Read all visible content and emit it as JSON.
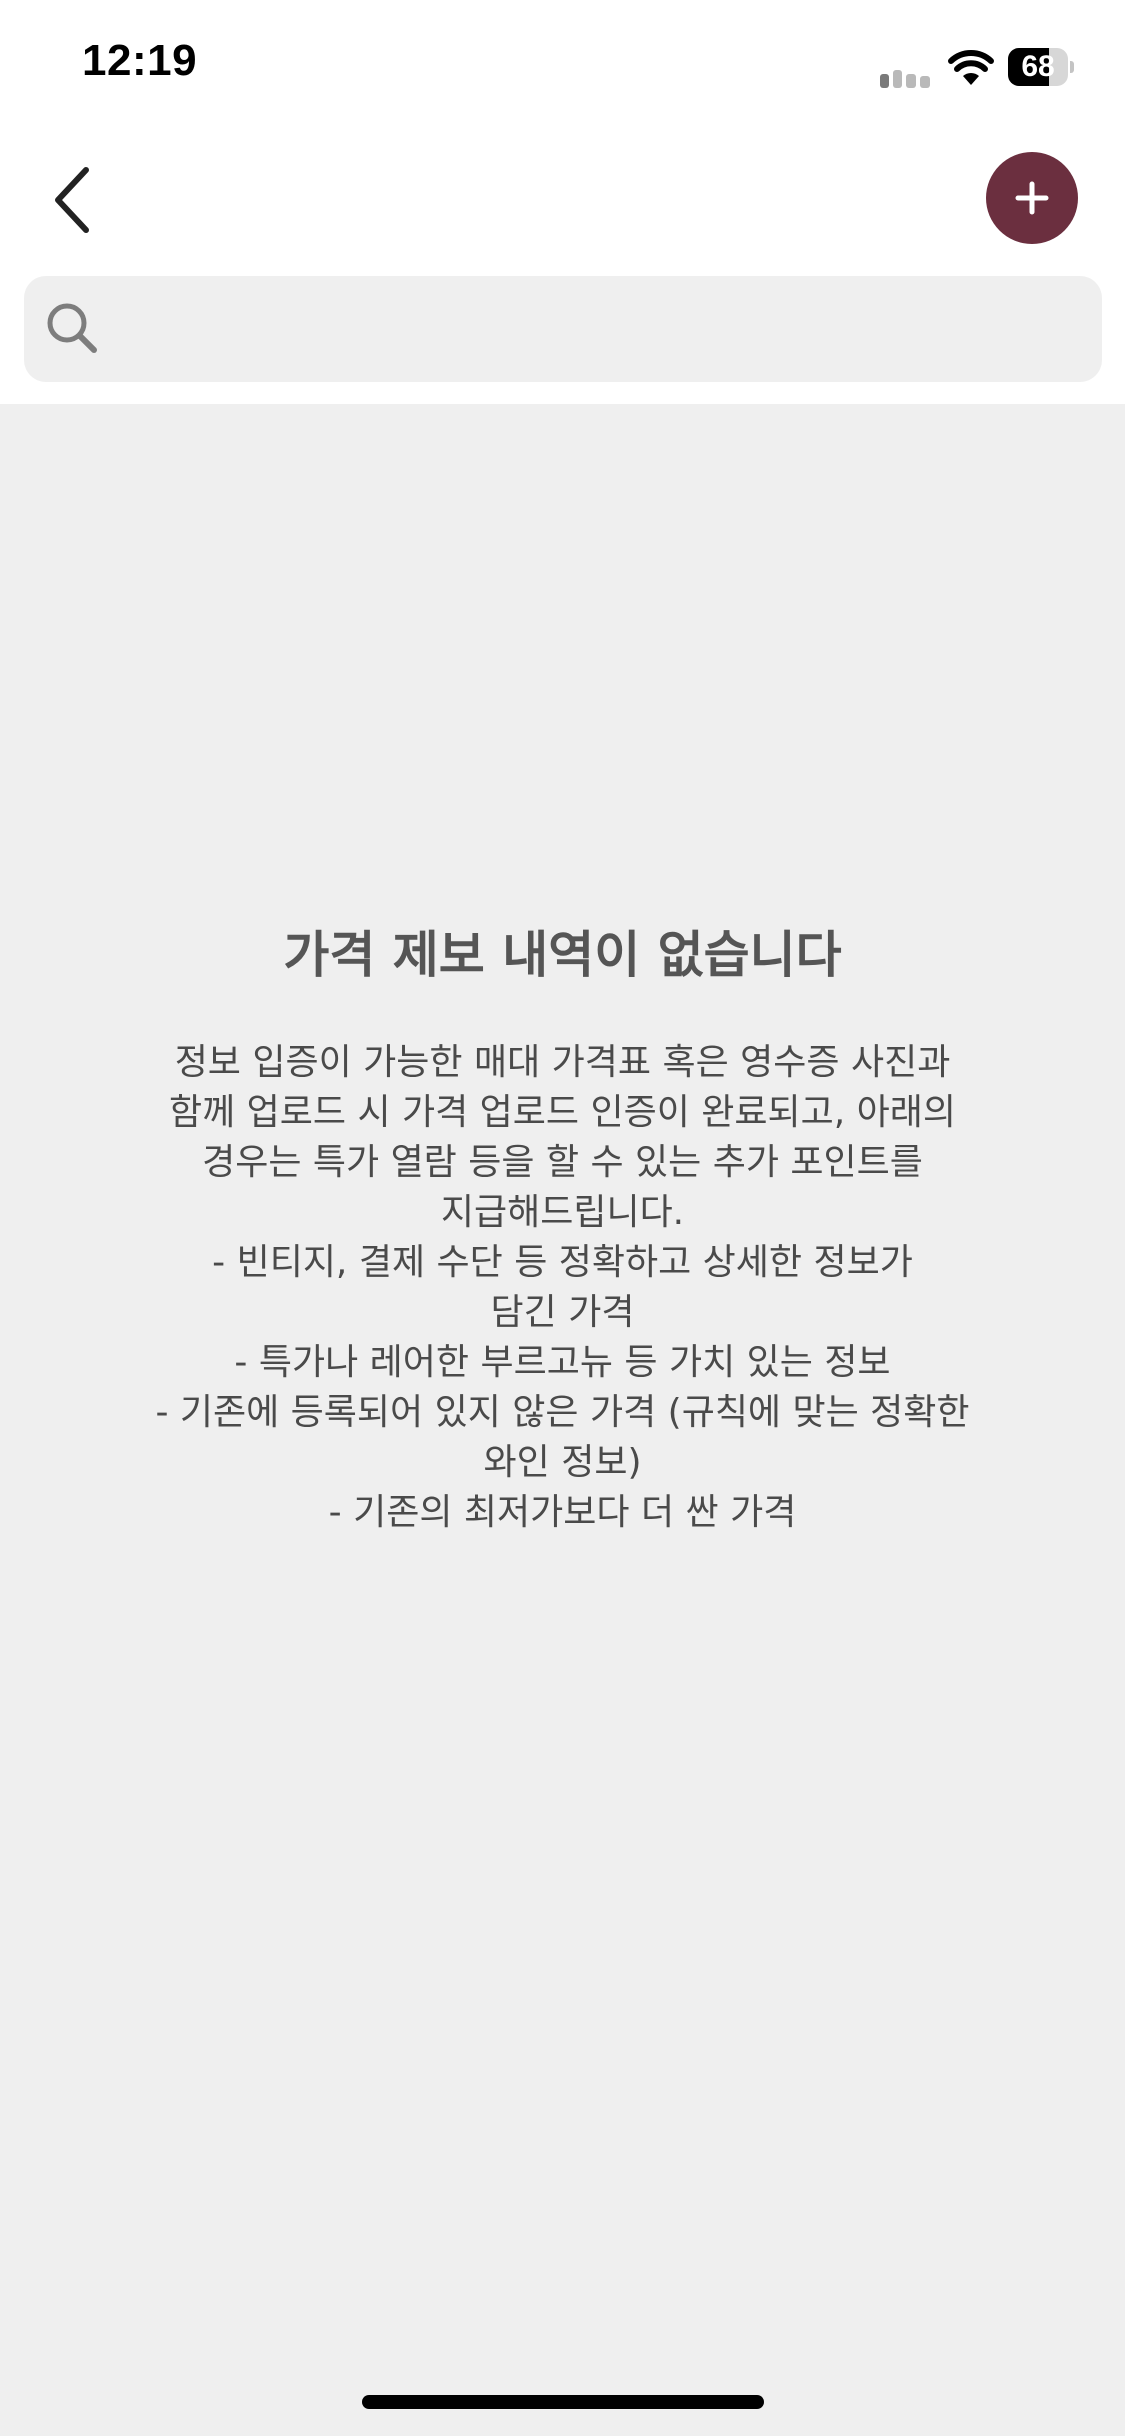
{
  "status_bar": {
    "time": "12:19",
    "battery_level": "68",
    "battery_fraction": 0.68,
    "icons": [
      "signal-icon",
      "wifi-icon",
      "battery-icon"
    ]
  },
  "nav": {
    "back_icon": "chevron-left-icon",
    "add_icon": "plus-icon",
    "accent_color": "#6b2f3f"
  },
  "search": {
    "placeholder": "",
    "value": "",
    "icon": "search-icon"
  },
  "empty_state": {
    "title": "가격 제보 내역이 없습니다",
    "description_lines": [
      "정보 입증이 가능한 매대 가격표 혹은 영수증 사진과",
      "함께 업로드 시 가격 업로드 인증이 완료되고, 아래의",
      "경우는 특가 열람 등을 할 수 있는 추가 포인트를",
      "지급해드립니다.",
      "- 빈티지, 결제 수단 등 정확하고 상세한 정보가",
      "담긴 가격",
      "- 특가나 레어한 부르고뉴 등 가치 있는 정보",
      "- 기존에 등록되어 있지 않은 가격 (규칙에 맞는 정확한",
      "와인 정보)",
      "- 기존의 최저가보다 더 싼 가격"
    ]
  }
}
